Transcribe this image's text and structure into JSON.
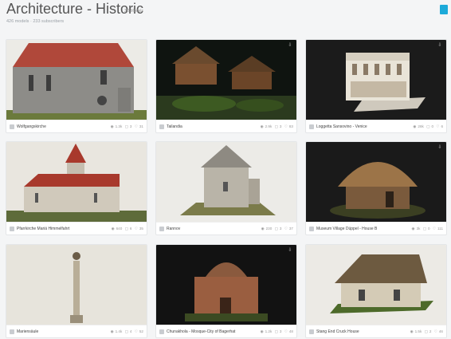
{
  "header": {
    "title": "Architecture - Historic",
    "tag": "3D Models",
    "subtitle": "426 models · 233 subscribers"
  },
  "cards": [
    {
      "name": "Wolfgangskirche",
      "views": "1.3k",
      "likes": "3",
      "comments": "31"
    },
    {
      "name": "Tailandia",
      "views": "2.9k",
      "likes": "3",
      "comments": "83"
    },
    {
      "name": "Loggetta Sansovino - Venice",
      "views": "28k",
      "likes": "0",
      "comments": "6"
    },
    {
      "name": "Pfarrkirche Mariä Himmelfahrt",
      "views": "640",
      "likes": "6",
      "comments": "35"
    },
    {
      "name": "Rannov",
      "views": "230",
      "likes": "3",
      "comments": "37"
    },
    {
      "name": "Museum Village Düppel - House B",
      "views": "3k",
      "likes": "0",
      "comments": "111"
    },
    {
      "name": "Mariensäule",
      "views": "1.4k",
      "likes": "4",
      "comments": "52"
    },
    {
      "name": "Chunakhola - Mosque-City of Bagerhat",
      "views": "1.2k",
      "likes": "3",
      "comments": "48"
    },
    {
      "name": "Stang End Cruck House",
      "views": "1.5k",
      "likes": "2",
      "comments": "46"
    }
  ],
  "icons": {
    "views": "eye-icon",
    "likes": "heart-icon",
    "comments": "comment-icon",
    "download": "download-icon"
  },
  "colors": {
    "accent": "#1caad9"
  }
}
